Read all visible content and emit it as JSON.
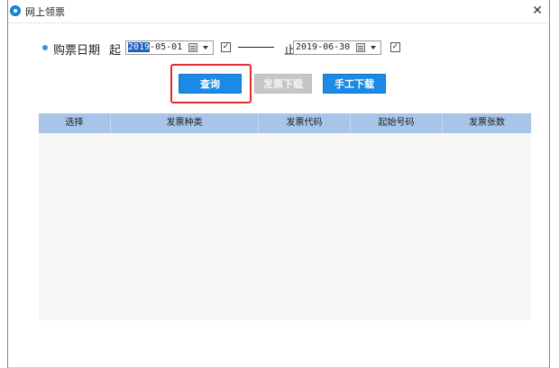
{
  "window": {
    "title": "网上领票",
    "close_glyph": "✕"
  },
  "filter": {
    "label": "购票日期",
    "from_label": "起",
    "from_year_selected": "2019",
    "from_rest": "-05-01",
    "to_label": "止",
    "to_date": "2019-06-30",
    "from_checked": true,
    "to_checked": true,
    "check_glyph": "✓"
  },
  "buttons": {
    "query": "查询",
    "download": "发票下载",
    "manual": "手工下载"
  },
  "table": {
    "columns": [
      "选择",
      "发票种类",
      "发票代码",
      "起始号码",
      "发票张数"
    ],
    "rows": []
  },
  "colors": {
    "accent": "#1a8ae6",
    "header_bg": "#a8c4e8",
    "highlight": "#e52a2a"
  },
  "icons": {
    "app": "app-logo-icon",
    "calendar": "calendar-icon",
    "dropdown": "chevron-down-icon",
    "close": "close-icon"
  }
}
